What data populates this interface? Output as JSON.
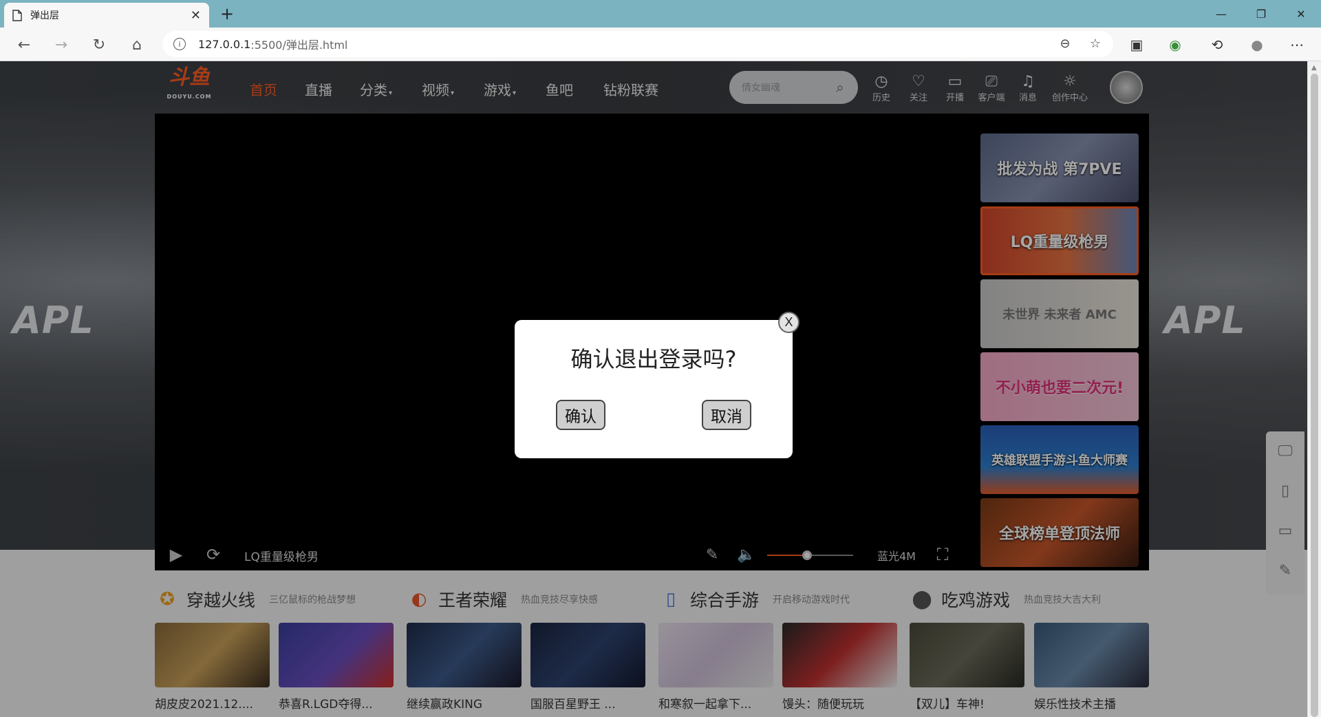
{
  "browser": {
    "tab_title": "弹出层",
    "tab_close": "✕",
    "new_tab": "+",
    "url_host": "127.0.0.1",
    "url_rest": ":5500/弹出层.html",
    "window_controls": [
      "—",
      "❐",
      "✕"
    ]
  },
  "site": {
    "logo_text": "斗鱼",
    "logo_sub": "DOUYU.COM",
    "nav": [
      {
        "label": "首页",
        "active": true
      },
      {
        "label": "直播"
      },
      {
        "label": "分类",
        "caret": "▾"
      },
      {
        "label": "视频",
        "caret": "▾"
      },
      {
        "label": "游戏",
        "caret": "▾"
      },
      {
        "label": "鱼吧"
      },
      {
        "label": "钻粉联赛"
      }
    ],
    "search_placeholder": "倩女幽魂",
    "header_icons": [
      {
        "label": "历史",
        "icon": "history-icon"
      },
      {
        "label": "关注",
        "icon": "heart-icon"
      },
      {
        "label": "开播",
        "icon": "camera-icon"
      },
      {
        "label": "客户端",
        "icon": "client-icon"
      },
      {
        "label": "消息",
        "icon": "bell-icon"
      },
      {
        "label": "创作中心",
        "icon": "bulb-icon"
      }
    ],
    "hero_brand": "APL"
  },
  "player": {
    "room_name": "LQ重量级枪男",
    "quality": "蓝光4M",
    "volume_fraction": 0.46
  },
  "thumbnails": [
    {
      "title": "批发为战 第7PVE"
    },
    {
      "title": "LQ重量级枪男",
      "active": true
    },
    {
      "title": "未世界 未来者 AMC"
    },
    {
      "title": "不小萌也要二次元!"
    },
    {
      "title": "英雄联盟手游斗鱼大师赛"
    },
    {
      "title": "全球榜单登顶法师"
    }
  ],
  "categories": [
    {
      "name": "穿越火线",
      "desc": "三亿鼠标的枪战梦想",
      "icon": "cf-icon"
    },
    {
      "name": "王者荣耀",
      "desc": "热血竞技尽享快感",
      "icon": "kog-icon"
    },
    {
      "name": "综合手游",
      "desc": "开启移动游戏时代",
      "icon": "mobile-game-icon"
    },
    {
      "name": "吃鸡游戏",
      "desc": "热血竞技大吉大利",
      "icon": "pubg-icon"
    }
  ],
  "streams": [
    {
      "label": "胡皮皮2021.12...."
    },
    {
      "label": "恭喜R.LGD夺得..."
    },
    {
      "label": "继续赢政KING"
    },
    {
      "label": "国服百星野王 ..."
    },
    {
      "label": "和寒叙一起拿下..."
    },
    {
      "label": "馒头：随便玩玩"
    },
    {
      "label": "【双儿】车神!"
    },
    {
      "label": "娱乐性技术主播"
    }
  ],
  "modal": {
    "title": "确认退出登录吗?",
    "confirm": "确认",
    "cancel": "取消",
    "close": "X"
  },
  "colors": {
    "accent": "#ff5d23",
    "tabbar": "#7bb3c1"
  }
}
